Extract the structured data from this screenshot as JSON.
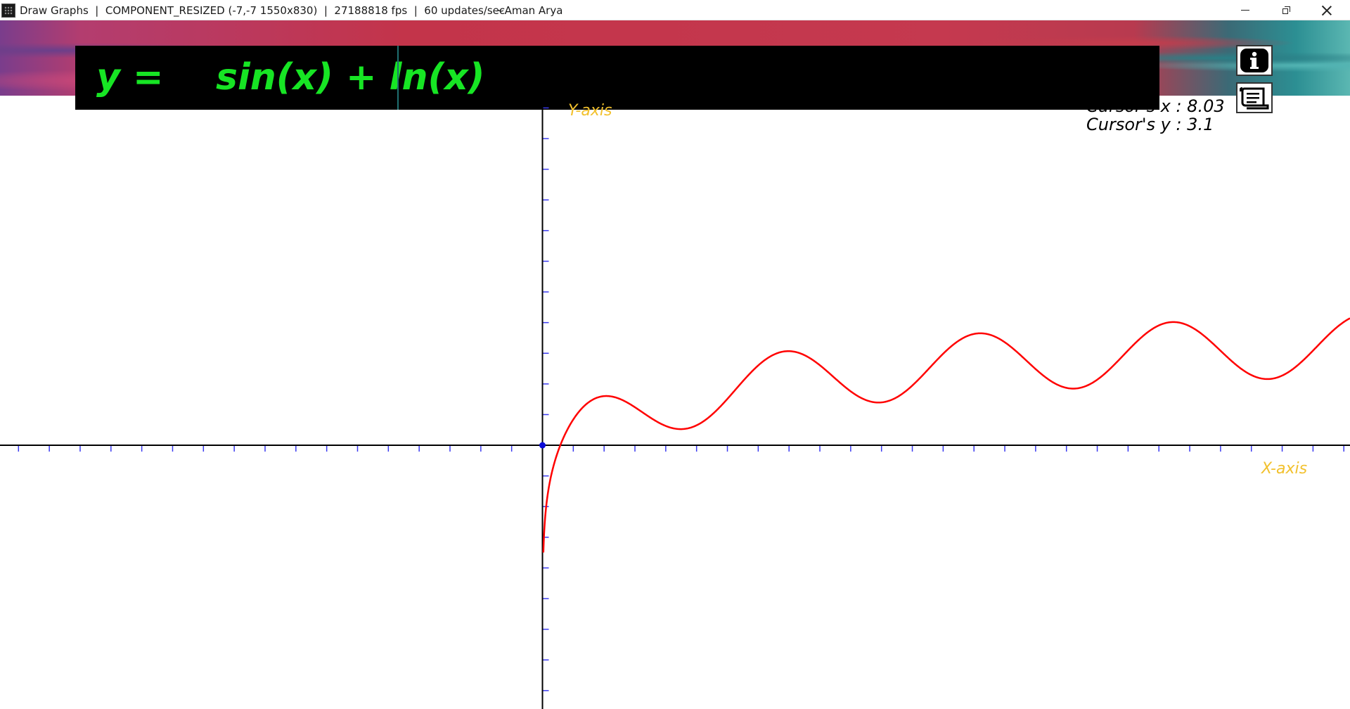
{
  "window": {
    "title": "Draw Graphs  |  COMPONENT_RESIZED (-7,-7 1550x830)  |  27188818 fps  |  60 updates/sec",
    "author": "~Aman Arya"
  },
  "equation": {
    "prefix": "y =",
    "input": "sin(x) + ln(x)",
    "text_color": "#17e524"
  },
  "toolbar": {
    "info_icon": "info-icon",
    "scroll_icon": "scroll-icon"
  },
  "cursor": {
    "x_label": "Cursor's x : 8.03",
    "y_label": "Cursor's y : 3.1"
  },
  "axes": {
    "x_label": "X-axis",
    "y_label": "Y-axis",
    "label_color": "#f2c12e",
    "tick_color": "#3a3af0",
    "curve_color": "#ff0000"
  },
  "chart_data": {
    "type": "line",
    "function": "sin(x) + ln(x)",
    "xlabel": "X-axis",
    "ylabel": "Y-axis",
    "xlim": [
      -17.6,
      26.2
    ],
    "ylim": [
      -8.6,
      11.4
    ],
    "x_tick_step": 1,
    "y_tick_step": 1,
    "origin_marker": true,
    "grid": false
  }
}
